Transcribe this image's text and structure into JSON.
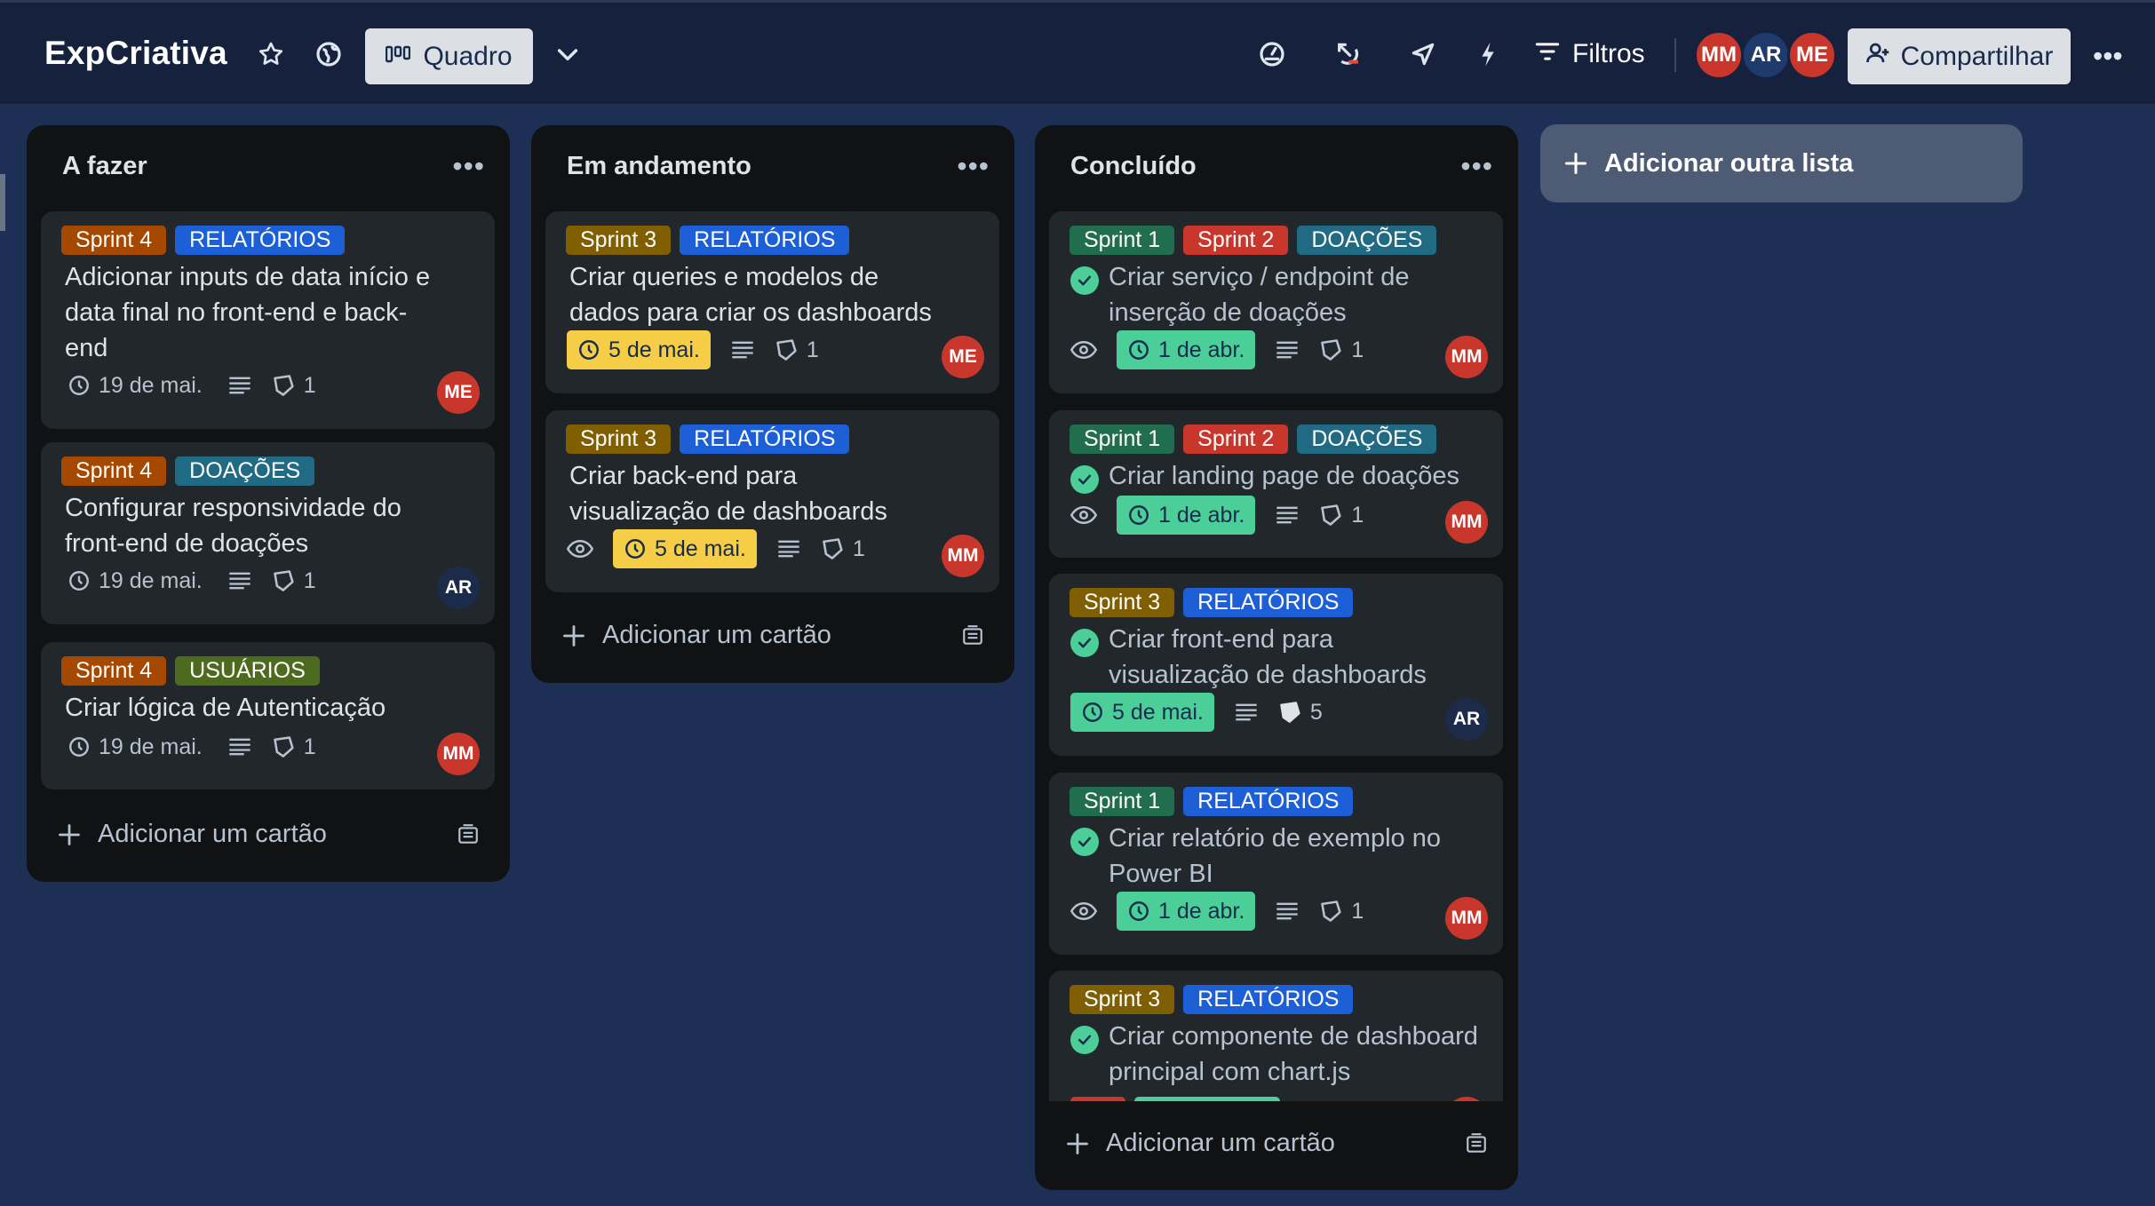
{
  "board": {
    "title": "ExpCriativa",
    "view_label": "Quadro",
    "filters_label": "Filtros",
    "share_label": "Compartilhar",
    "members": [
      {
        "initials": "MM",
        "color": "#c9372c"
      },
      {
        "initials": "AR",
        "color": "#1f3b6e"
      },
      {
        "initials": "ME",
        "color": "#c9372c"
      }
    ]
  },
  "colors": {
    "sprint4": "#a54800",
    "sprint3": "#7f5f01",
    "sprint1": "#216e4e",
    "sprint2": "#c9372c",
    "relatorios": "#1d5fd6",
    "doacoes": "#206a83",
    "usuarios": "#4c6b1f"
  },
  "lists": [
    {
      "title": "A fazer",
      "add_card": "Adicionar um cartão",
      "cards": [
        {
          "labels": [
            {
              "text": "Sprint 4",
              "color": "#a54800"
            },
            {
              "text": "RELATÓRIOS",
              "color": "#1d5fd6"
            }
          ],
          "title_lines": [
            "Adicionar inputs de data início e",
            "data final no front-end e back-",
            "end"
          ],
          "due": "19 de mai.",
          "checklist": "1",
          "member": {
            "initials": "ME",
            "color": "#c9372c"
          }
        },
        {
          "labels": [
            {
              "text": "Sprint 4",
              "color": "#a54800"
            },
            {
              "text": "DOAÇÕES",
              "color": "#206a83"
            }
          ],
          "title_lines": [
            "Configurar responsividade do",
            "front-end de doações"
          ],
          "due": "19 de mai.",
          "checklist": "1",
          "member": {
            "initials": "AR",
            "color": "#1c2b4a"
          }
        },
        {
          "labels": [
            {
              "text": "Sprint 4",
              "color": "#a54800"
            },
            {
              "text": "USUÁRIOS",
              "color": "#4c6b1f"
            }
          ],
          "title_lines": [
            "Criar lógica de Autenticação"
          ],
          "due": "19 de mai.",
          "checklist": "1",
          "member": {
            "initials": "MM",
            "color": "#c9372c"
          }
        }
      ]
    },
    {
      "title": "Em andamento",
      "add_card": "Adicionar um cartão",
      "cards": [
        {
          "labels": [
            {
              "text": "Sprint 3",
              "color": "#7f5f01"
            },
            {
              "text": "RELATÓRIOS",
              "color": "#1d5fd6"
            }
          ],
          "title_lines": [
            "Criar queries e modelos de",
            "dados para criar os dashboards"
          ],
          "due": "5 de mai.",
          "checklist": "1",
          "member": {
            "initials": "ME",
            "color": "#c9372c"
          }
        },
        {
          "labels": [
            {
              "text": "Sprint 3",
              "color": "#7f5f01"
            },
            {
              "text": "RELATÓRIOS",
              "color": "#1d5fd6"
            }
          ],
          "title_lines": [
            "Criar back-end para",
            "visualização de dashboards"
          ],
          "due": "5 de mai.",
          "checklist": "1",
          "member": {
            "initials": "MM",
            "color": "#c9372c"
          }
        }
      ]
    },
    {
      "title": "Concluído",
      "add_card": "Adicionar um cartão",
      "cards": [
        {
          "labels": [
            {
              "text": "Sprint 1",
              "color": "#216e4e"
            },
            {
              "text": "Sprint 2",
              "color": "#c9372c"
            },
            {
              "text": "DOAÇÕES",
              "color": "#206a83"
            }
          ],
          "title_lines": [
            "Criar serviço / endpoint de",
            "inserção de doações"
          ],
          "due": "1 de abr.",
          "checklist": "1",
          "member": {
            "initials": "MM",
            "color": "#c9372c"
          }
        },
        {
          "labels": [
            {
              "text": "Sprint 1",
              "color": "#216e4e"
            },
            {
              "text": "Sprint 2",
              "color": "#c9372c"
            },
            {
              "text": "DOAÇÕES",
              "color": "#206a83"
            }
          ],
          "title_lines": [
            "Criar landing page de doações"
          ],
          "due": "1 de abr.",
          "checklist": "1",
          "member": {
            "initials": "MM",
            "color": "#c9372c"
          }
        },
        {
          "labels": [
            {
              "text": "Sprint 3",
              "color": "#7f5f01"
            },
            {
              "text": "RELATÓRIOS",
              "color": "#1d5fd6"
            }
          ],
          "title_lines": [
            "Criar front-end para",
            "visualização de dashboards"
          ],
          "due": "5 de mai.",
          "checklist": "5",
          "member": {
            "initials": "AR",
            "color": "#1c2b4a"
          }
        },
        {
          "labels": [
            {
              "text": "Sprint 1",
              "color": "#216e4e"
            },
            {
              "text": "RELATÓRIOS",
              "color": "#1d5fd6"
            }
          ],
          "title_lines": [
            "Criar relatório de exemplo no",
            "Power BI"
          ],
          "due": "1 de abr.",
          "checklist": "1",
          "member": {
            "initials": "MM",
            "color": "#c9372c"
          }
        },
        {
          "labels": [
            {
              "text": "Sprint 3",
              "color": "#7f5f01"
            },
            {
              "text": "RELATÓRIOS",
              "color": "#1d5fd6"
            }
          ],
          "title_lines": [
            "Criar componente de dashboard",
            "principal com chart.js"
          ]
        }
      ]
    }
  ],
  "add_list_label": "Adicionar outra lista"
}
